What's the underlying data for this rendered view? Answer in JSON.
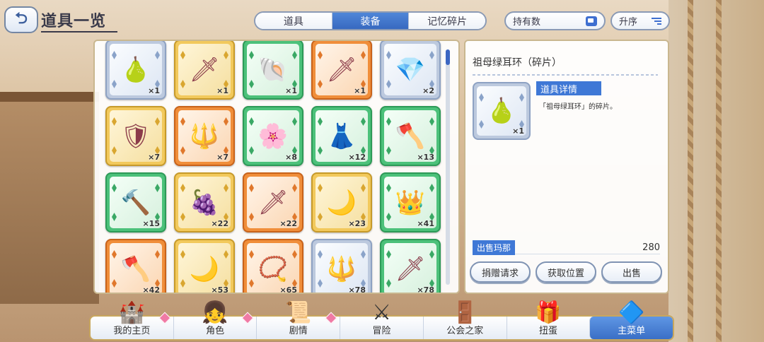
{
  "header": {
    "title": "道具一览",
    "tabs": [
      {
        "label": "道具",
        "active": false
      },
      {
        "label": "装备",
        "active": true
      },
      {
        "label": "记忆碎片",
        "active": false
      }
    ],
    "filter_label": "持有数",
    "sort_label": "升序"
  },
  "items": [
    {
      "icon": "earring-icon",
      "color": "blue",
      "qty": "×1",
      "glyph": "🍐"
    },
    {
      "icon": "staff-icon",
      "color": "gold",
      "qty": "×1",
      "glyph": "🗡"
    },
    {
      "icon": "shell-icon",
      "color": "green",
      "qty": "×1",
      "glyph": "🐚"
    },
    {
      "icon": "spear-icon",
      "color": "orange",
      "qty": "×1",
      "glyph": "🗡"
    },
    {
      "icon": "pendant-icon",
      "color": "blue",
      "qty": "×2",
      "glyph": "💎"
    },
    {
      "icon": "shield-icon",
      "color": "gold",
      "qty": "×7",
      "glyph": "🛡"
    },
    {
      "icon": "spear-icon",
      "color": "orange",
      "qty": "×7",
      "glyph": "🔱"
    },
    {
      "icon": "scepter-icon",
      "color": "green",
      "qty": "×8",
      "glyph": "🌸"
    },
    {
      "icon": "dress-icon",
      "color": "green",
      "qty": "×12",
      "glyph": "👗"
    },
    {
      "icon": "axe-icon",
      "color": "green",
      "qty": "×13",
      "glyph": "🪓"
    },
    {
      "icon": "mace-icon",
      "color": "green",
      "qty": "×15",
      "glyph": "🔨"
    },
    {
      "icon": "grapes-icon",
      "color": "gold",
      "qty": "×22",
      "glyph": "🍇"
    },
    {
      "icon": "sword-icon",
      "color": "orange",
      "qty": "×22",
      "glyph": "🗡"
    },
    {
      "icon": "moon-amulet-icon",
      "color": "gold",
      "qty": "×23",
      "glyph": "🌙"
    },
    {
      "icon": "crown-icon",
      "color": "green",
      "qty": "×41",
      "glyph": "👑"
    },
    {
      "icon": "axe-icon",
      "color": "orange",
      "qty": "×42",
      "glyph": "🪓"
    },
    {
      "icon": "moon-staff-icon",
      "color": "gold",
      "qty": "×53",
      "glyph": "🌙"
    },
    {
      "icon": "necklace-icon",
      "color": "orange",
      "qty": "×65",
      "glyph": "📿"
    },
    {
      "icon": "spear-icon",
      "color": "blue",
      "qty": "×78",
      "glyph": "🔱"
    },
    {
      "icon": "sword-icon",
      "color": "green",
      "qty": "×78",
      "glyph": "🗡"
    }
  ],
  "detail": {
    "name": "祖母绿耳环（碎片）",
    "icon": "earring-icon",
    "glyph": "🍐",
    "qty": "×1",
    "badge": "道具详情",
    "description": "「祖母绿耳环」的碎片。",
    "sell_label": "出售玛那",
    "sell_value": "280",
    "buttons": [
      "捐赠请求",
      "获取位置",
      "出售"
    ]
  },
  "nav": [
    {
      "label": "我的主页",
      "icon": "castle-icon",
      "glyph": "🏰",
      "badge": true
    },
    {
      "label": "角色",
      "icon": "character-icon",
      "glyph": "👧",
      "badge": true
    },
    {
      "label": "剧情",
      "icon": "scroll-icon",
      "glyph": "📜",
      "badge": true
    },
    {
      "label": "冒险",
      "icon": "sword-flag-icon",
      "glyph": "⚔",
      "badge": false
    },
    {
      "label": "公会之家",
      "icon": "house-icon",
      "glyph": "🚪",
      "badge": false
    },
    {
      "label": "扭蛋",
      "icon": "gacha-icon",
      "glyph": "🎁",
      "badge": false
    },
    {
      "label": "主菜单",
      "icon": "crystal-menu-icon",
      "glyph": "🔷",
      "badge": false,
      "active": true
    }
  ]
}
